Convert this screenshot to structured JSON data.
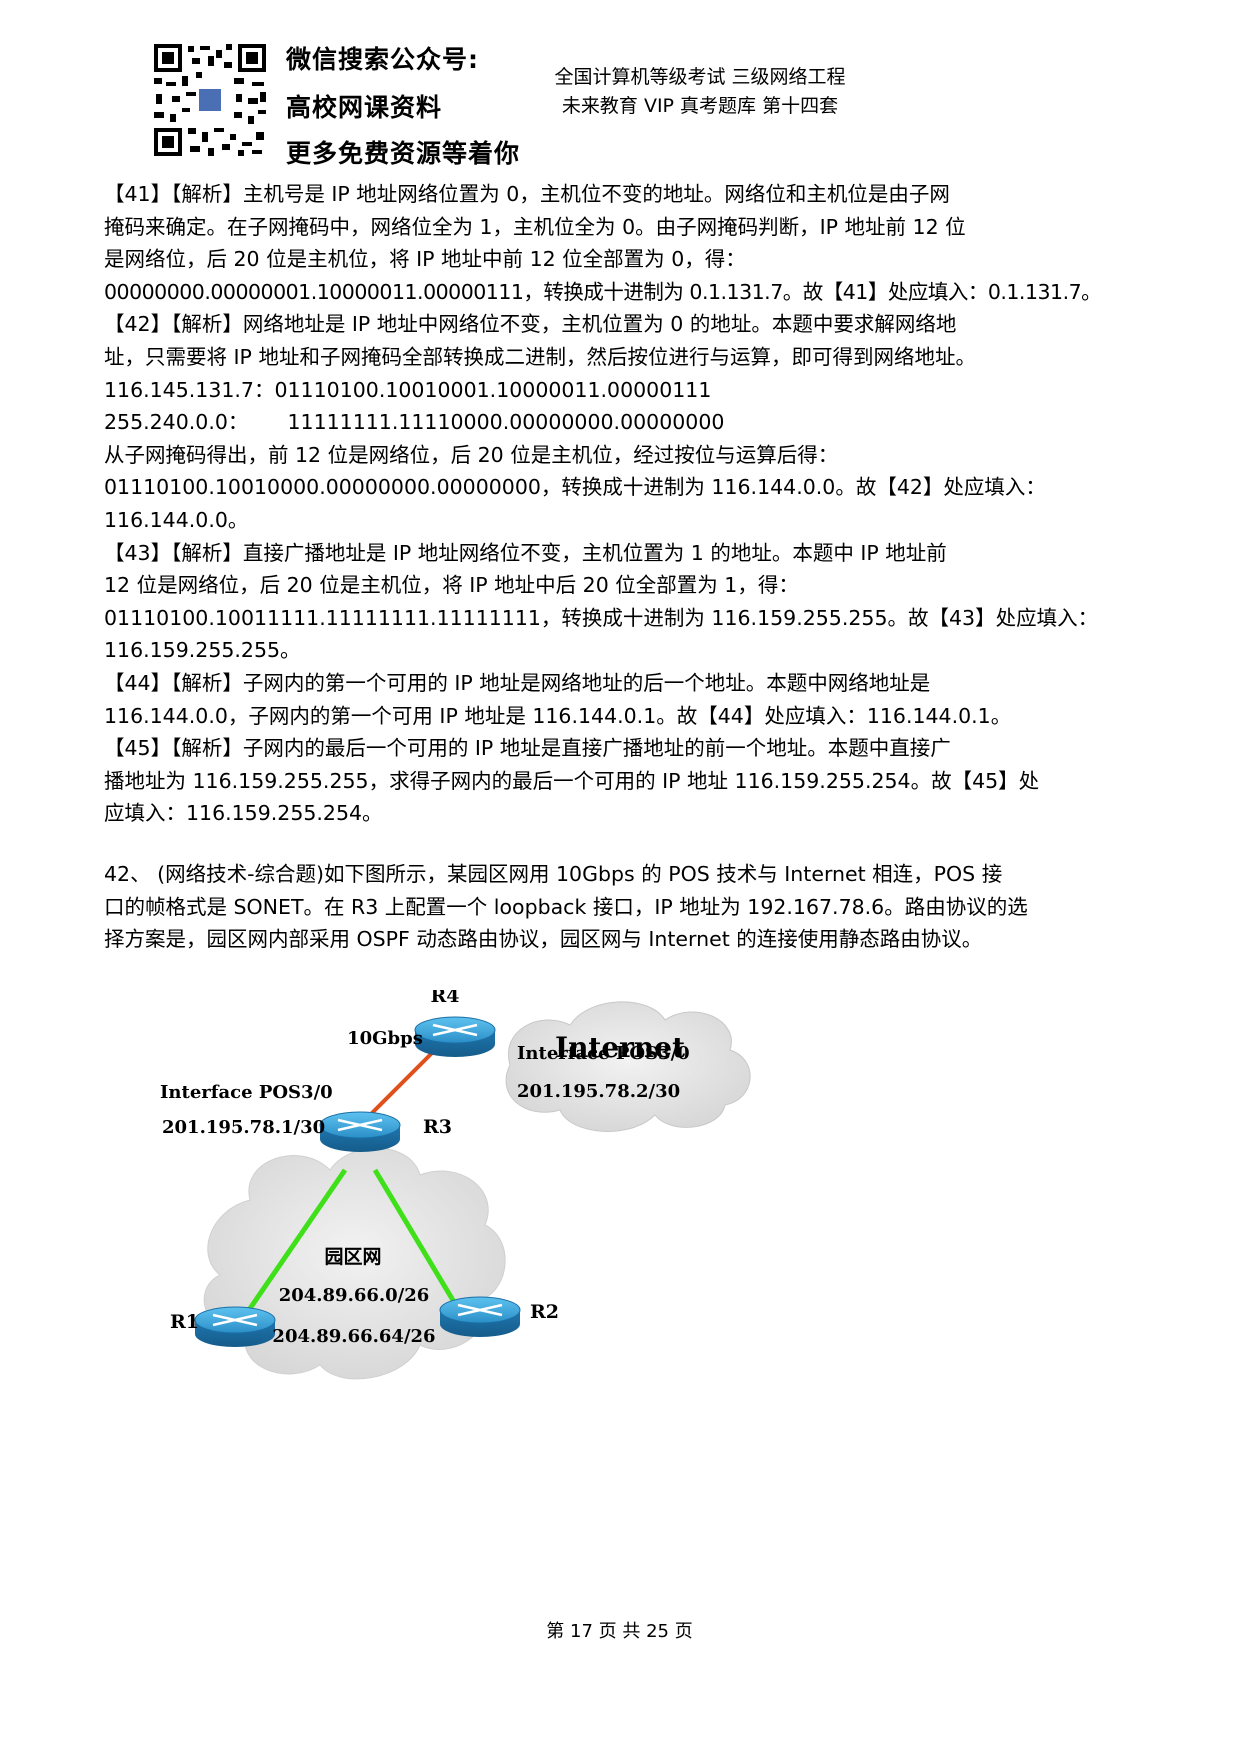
{
  "header": {
    "qr_label": "高校网课资料",
    "slogan_1": "微信搜索公众号:",
    "slogan_2": "高校网课资料",
    "slogan_3": "更多免费资源等着你",
    "title_1": "全国计算机等级考试 三级网络工程",
    "title_2": "未来教育 VIP 真考题库 第十四套"
  },
  "body": {
    "lines": [
      "【41】【解析】主机号是 IP 地址网络位置为 0，主机位不变的地址。网络位和主机位是由子网",
      "掩码来确定。在子网掩码中，网络位全为 1，主机位全为 0。由子网掩码判断，IP 地址前 12 位",
      "是网络位，后 20 位是主机位，将 IP 地址中前 12 位全部置为 0，得：",
      "00000000.00000001.10000011.00000111，转换成十进制为 0.1.131.7。故【41】处应填入：0.1.131.7。",
      "【42】【解析】网络地址是 IP 地址中网络位不变，主机位置为 0 的地址。本题中要求解网络地",
      "址，只需要将 IP 地址和子网掩码全部转换成二进制，然后按位进行与运算，即可得到网络地址。",
      "116.145.131.7：01110100.10010001.10000011.00000111",
      "255.240.0.0：      11111111.11110000.00000000.00000000",
      "从子网掩码得出，前 12 位是网络位，后 20 位是主机位，经过按位与运算后得：",
      "01110100.10010000.00000000.00000000，转换成十进制为 116.144.0.0。故【42】处应填入：",
      "116.144.0.0。",
      "【43】【解析】直接广播地址是 IP 地址网络位不变，主机位置为 1 的地址。本题中 IP 地址前",
      "12 位是网络位，后 20 位是主机位，将 IP 地址中后 20 位全部置为 1，得：",
      "01110100.10011111.11111111.11111111，转换成十进制为 116.159.255.255。故【43】处应填入：",
      "116.159.255.255。",
      "【44】【解析】子网内的第一个可用的 IP 地址是网络地址的后一个地址。本题中网络地址是",
      "116.144.0.0，子网内的第一个可用 IP 地址是 116.144.0.1。故【44】处应填入：116.144.0.1。",
      "【45】【解析】子网内的最后一个可用的 IP 地址是直接广播地址的前一个地址。本题中直接广",
      "播地址为 116.159.255.255，求得子网内的最后一个可用的 IP 地址 116.159.255.254。故【45】处",
      "应填入：116.159.255.254。"
    ]
  },
  "question": {
    "lines": [
      "42、 (网络技术-综合题)如下图所示，某园区网用 10Gbps 的 POS 技术与 Internet 相连，POS 接",
      "口的帧格式是 SONET。在 R3 上配置一个 loopback 接口，IP 地址为 192.167.78.6。路由协议的选",
      "择方案是，园区网内部采用 OSPF 动态路由协议，园区网与 Internet 的连接使用静态路由协议。"
    ]
  },
  "diagram": {
    "r4": "R4",
    "internet": "Internet",
    "speed": "10Gbps",
    "r4_if": "Interface POS3/0",
    "r4_ip": "201.195.78.2/30",
    "r3_if": "Interface POS3/0",
    "r3_ip": "201.195.78.1/30",
    "r3": "R3",
    "campus": "园区网",
    "net1": "204.89.66.0/26",
    "net2": "204.89.66.64/26",
    "r1": "R1",
    "r2": "R2",
    "colors": {
      "wan_link": "#e0501c",
      "lan_link": "#3fe01a",
      "router": "#3aa7df",
      "cloud": "#e2e2e2"
    }
  },
  "footer": {
    "text": "第 17 页 共 25 页"
  }
}
